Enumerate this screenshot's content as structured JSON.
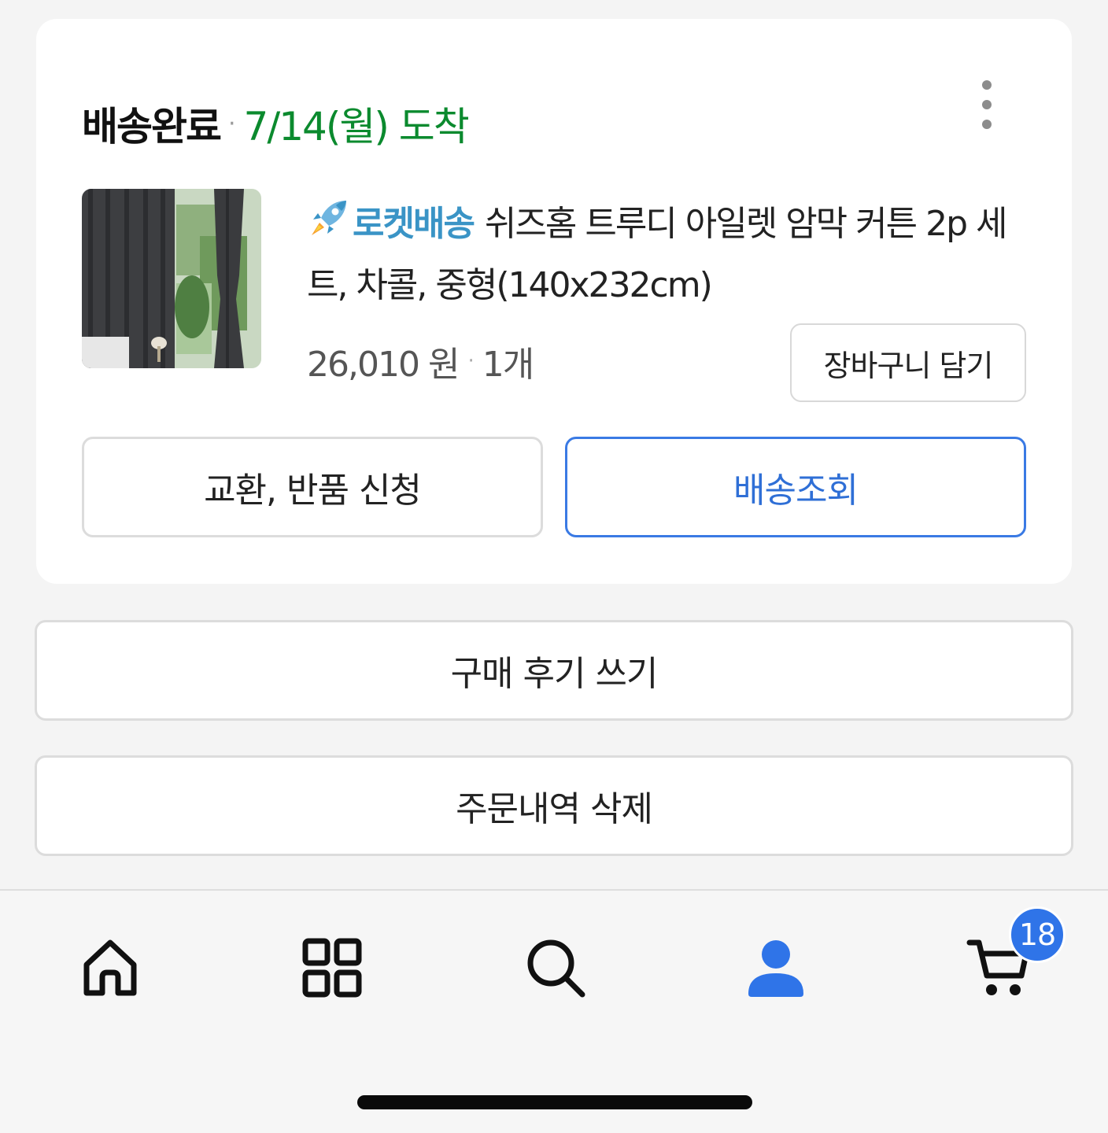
{
  "order": {
    "status": "배송완료",
    "arrival": "7/14(월) 도착",
    "more_icon": "more-vertical-icon",
    "product": {
      "badge": "로켓배송",
      "name": "쉬즈홈 트루디 아일렛 암막 커튼 2p 세트, 차콜, 중형(140x232cm)",
      "price": "26,010 원",
      "quantity": "1개",
      "image": "charcoal blackout curtain thumbnail"
    },
    "actions": {
      "add_to_cart": "장바구니 담기",
      "exchange_return": "교환, 반품 신청",
      "track_delivery": "배송조회"
    },
    "colors": {
      "status_green": "#0b8a2e",
      "rocket_blue": "#3a94c6",
      "accent_blue": "#2f6fd6"
    }
  },
  "extra_actions": {
    "write_review": "구매 후기 쓰기",
    "delete_order": "주문내역 삭제"
  },
  "tab_bar": {
    "items": [
      {
        "icon": "home-icon",
        "active": false
      },
      {
        "icon": "categories-icon",
        "active": false
      },
      {
        "icon": "search-icon",
        "active": false
      },
      {
        "icon": "user-icon",
        "active": true
      },
      {
        "icon": "cart-icon",
        "active": false
      }
    ],
    "cart_count": "18",
    "active_color": "#2f74e8"
  }
}
